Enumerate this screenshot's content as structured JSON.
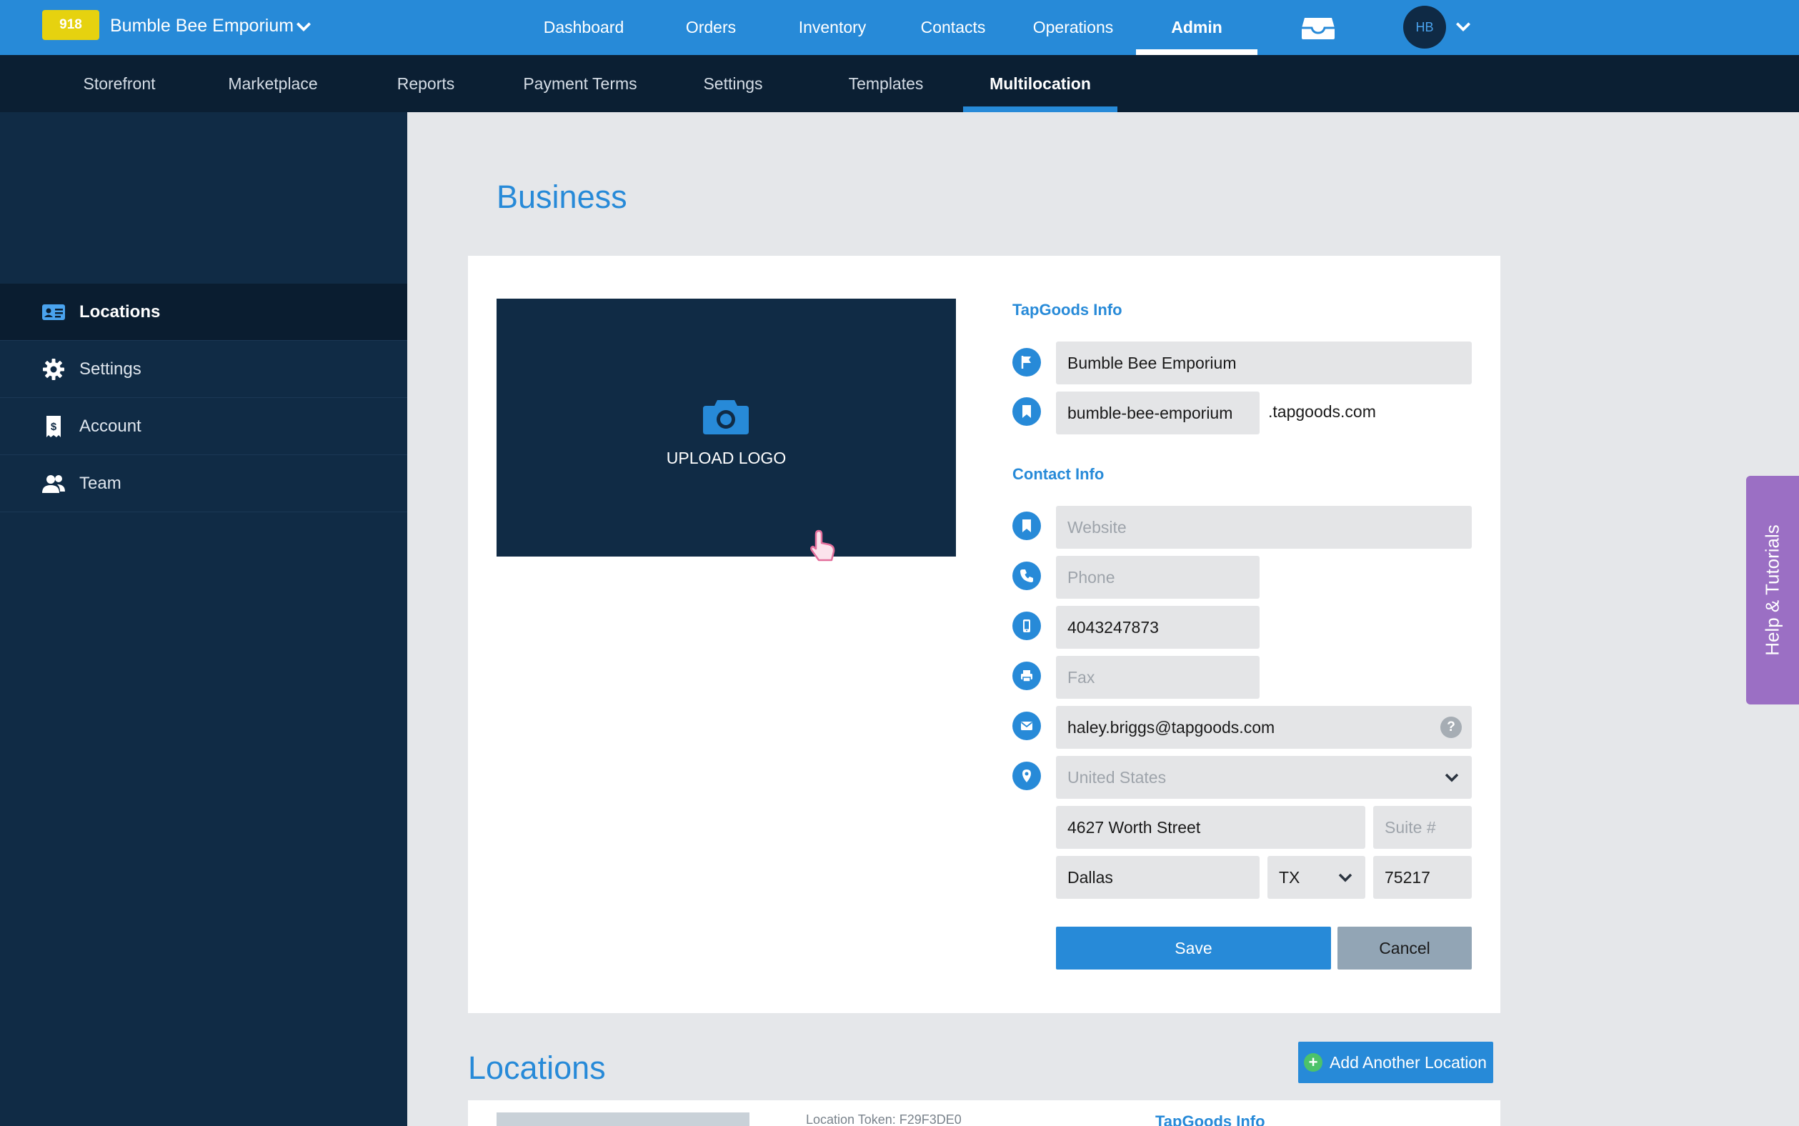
{
  "header": {
    "business_badge": "918",
    "business_name": "Bumble Bee Emporium",
    "nav": [
      "Dashboard",
      "Orders",
      "Inventory",
      "Contacts",
      "Operations",
      "Admin"
    ],
    "active_nav": "Admin",
    "user_initials": "HB"
  },
  "subnav": {
    "items": [
      "Storefront",
      "Marketplace",
      "Reports",
      "Payment Terms",
      "Settings",
      "Templates",
      "Multilocation"
    ],
    "active": "Multilocation"
  },
  "sidebar": {
    "items": [
      {
        "label": "Locations",
        "icon": "id-card-icon"
      },
      {
        "label": "Settings",
        "icon": "gear-icon"
      },
      {
        "label": "Account",
        "icon": "receipt-icon"
      },
      {
        "label": "Team",
        "icon": "team-icon"
      }
    ],
    "active": "Locations"
  },
  "business": {
    "title": "Business",
    "upload_logo_label": "UPLOAD LOGO",
    "tapgoods_info_label": "TapGoods Info",
    "contact_info_label": "Contact Info",
    "business_name_value": "Bumble Bee Emporium",
    "subdomain_value": "bumble-bee-emporium",
    "domain_suffix": ".tapgoods.com",
    "website_placeholder": "Website",
    "phone_placeholder": "Phone",
    "cell_value": "4043247873",
    "fax_placeholder": "Fax",
    "email_value": "haley.briggs@tapgoods.com",
    "country_value": "United States",
    "street_value": "4627 Worth Street",
    "suite_placeholder": "Suite #",
    "city_value": "Dallas",
    "state_value": "TX",
    "zip_value": "75217",
    "save_label": "Save",
    "cancel_label": "Cancel"
  },
  "locations": {
    "title": "Locations",
    "add_label": "Add Another Location",
    "token_text": "Location Token: F29F3DE0",
    "info_label": "TapGoods Info"
  },
  "help_tab": {
    "label": "Help & Tutorials"
  },
  "colors": {
    "primary": "#278ad8",
    "navy": "#102b45",
    "subbar": "#0b1f33",
    "badge": "#e6d20f",
    "help_tab": "#9b6fc4"
  }
}
